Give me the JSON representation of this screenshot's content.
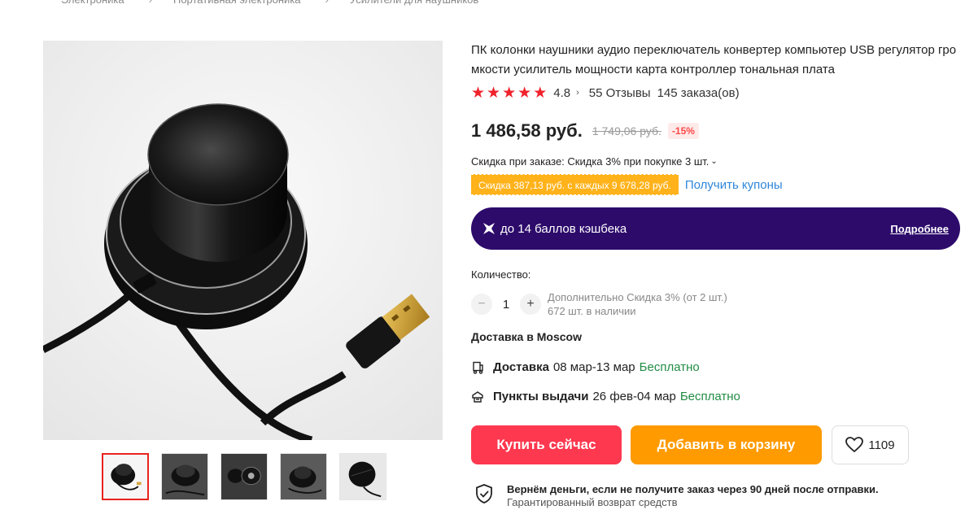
{
  "breadcrumb": [
    "Электроника",
    "Портативная электроника",
    "Усилители для наушников"
  ],
  "product": {
    "title": "ПК колонки наушники аудио переключатель конвертер компьютер USB регулятор громкости усилитель мощности карта контроллер тональная плата",
    "rating": "4.8",
    "stars": 5,
    "reviews": "55 Отзывы",
    "orders": "145 заказа(ов)"
  },
  "price": {
    "current": "1 486,58 руб.",
    "old": "1 749,06 руб.",
    "discount": "-15%"
  },
  "order_discount": "Скидка при заказе: Скидка 3% при покупке 3 шт.",
  "coupon": {
    "badge": "Скидка 387,13 руб. с каждых 9 678,28 руб.",
    "link": "Получить купоны"
  },
  "cashback": {
    "text": "до 14 баллов кэшбека",
    "more": "Подробнее"
  },
  "quantity": {
    "label": "Количество:",
    "value": "1",
    "minus": "−",
    "plus": "+",
    "extra_discount": "Дополнительно Скидка 3% (от 2 шт.)",
    "stock": "672 шт. в наличии"
  },
  "delivery": {
    "heading": "Доставка в Moscow",
    "courier": {
      "label": "Доставка",
      "dates": "08 мар-13 мар",
      "price": "Бесплатно"
    },
    "pickup": {
      "label": "Пункты выдачи",
      "dates": "26 фев-04 мар",
      "price": "Бесплатно"
    }
  },
  "actions": {
    "buy": "Купить сейчас",
    "cart": "Добавить в корзину",
    "wishlist_count": "1109"
  },
  "guarantee": {
    "title": "Вернём деньги, если не получите заказ через 90 дней после отправки.",
    "subtitle": "Гарантированный возврат средств"
  },
  "colors": {
    "buy": "#fd384f",
    "cart": "#ff9a00",
    "cashback_bg": "#2d0b6b",
    "coupon": "#ffb21a",
    "free": "#228c45",
    "star": "#f0222c"
  }
}
